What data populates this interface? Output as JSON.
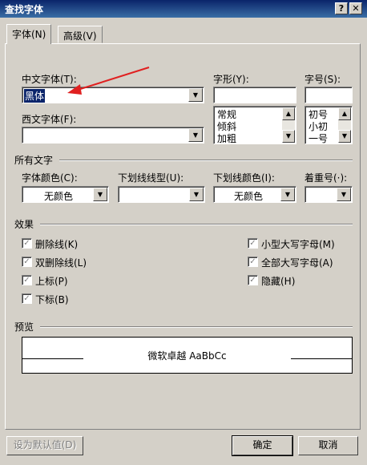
{
  "window": {
    "title": "查找字体",
    "help_label": "?",
    "close_label": "✕"
  },
  "tabs": [
    {
      "label": "字体(N)"
    },
    {
      "label": "高级(V)"
    }
  ],
  "font": {
    "chinese_label": "中文字体(T):",
    "chinese_value": "黑体",
    "western_label": "西文字体(F):",
    "western_value": "",
    "style_label": "字形(Y):",
    "style_value": "",
    "style_options": [
      "常规",
      "倾斜",
      "加粗"
    ],
    "size_label": "字号(S):",
    "size_value": "",
    "size_options": [
      "初号",
      "小初",
      "一号"
    ]
  },
  "all_text": {
    "section_label": "所有文字",
    "color_label": "字体颜色(C):",
    "color_value": "无颜色",
    "underline_type_label": "下划线线型(U):",
    "underline_type_value": "",
    "underline_color_label": "下划线颜色(I):",
    "underline_color_value": "无颜色",
    "emphasis_label": "着重号(·):",
    "emphasis_value": ""
  },
  "effects": {
    "section_label": "效果",
    "left": [
      {
        "label": "删除线(K)"
      },
      {
        "label": "双删除线(L)"
      },
      {
        "label": "上标(P)"
      },
      {
        "label": "下标(B)"
      }
    ],
    "right": [
      {
        "label": "小型大写字母(M)"
      },
      {
        "label": "全部大写字母(A)"
      },
      {
        "label": "隐藏(H)"
      }
    ],
    "check_glyph": "✓"
  },
  "preview": {
    "section_label": "预览",
    "sample_text": "微软卓越  AaBbCc"
  },
  "buttons": {
    "set_default": "设为默认值(D)",
    "ok": "确定",
    "cancel": "取消"
  },
  "icons": {
    "dropdown": "▼",
    "scroll_up": "▲",
    "scroll_down": "▼"
  },
  "colors": {
    "titlebar": "#0a246a",
    "dialog": "#d4d0c8",
    "annotation_arrow": "#e02020",
    "selection": "#0a246a"
  }
}
